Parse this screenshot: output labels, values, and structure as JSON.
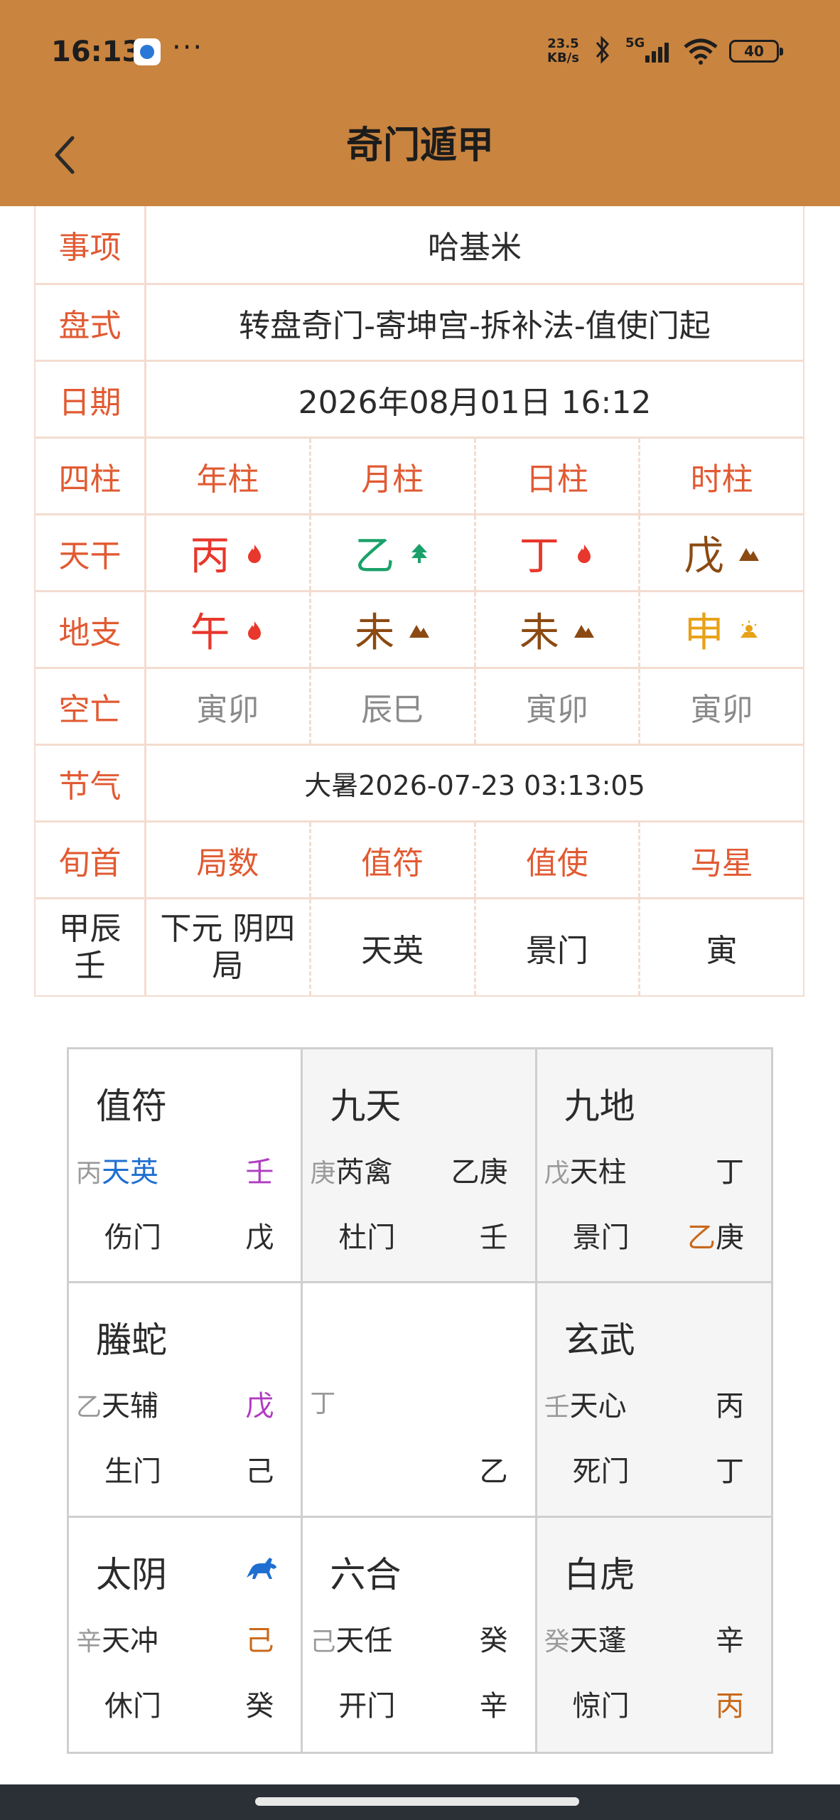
{
  "status_bar": {
    "time": "16:13",
    "more": "···",
    "net_speed_value": "23.5",
    "net_speed_unit": "KB/s",
    "network": "5G",
    "battery": "40",
    "icons": [
      "app-notification-icon",
      "bluetooth-icon",
      "cellular-signal-icon",
      "wifi-icon",
      "battery-icon"
    ]
  },
  "header": {
    "title": "奇门遁甲",
    "back_icon": "chevron-left-icon"
  },
  "info": {
    "matter": {
      "label": "事项",
      "value": "哈基米"
    },
    "layout": {
      "label": "盘式",
      "value": "转盘奇门-寄坤宫-拆补法-值使门起"
    },
    "date": {
      "label": "日期",
      "value": "2026年08月01日 16:12"
    },
    "pillars_header": {
      "label": "四柱",
      "cols": [
        "年柱",
        "月柱",
        "日柱",
        "时柱"
      ]
    },
    "stems": {
      "label": "天干",
      "values": [
        "丙",
        "乙",
        "丁",
        "戊"
      ],
      "elements": [
        "fire",
        "wood",
        "fire",
        "earth"
      ]
    },
    "branches": {
      "label": "地支",
      "values": [
        "午",
        "未",
        "未",
        "申"
      ],
      "elements": [
        "fire",
        "earth",
        "earth",
        "metal"
      ]
    },
    "void": {
      "label": "空亡",
      "values": [
        "寅卯",
        "辰巳",
        "寅卯",
        "寅卯"
      ]
    },
    "solar_term": {
      "label": "节气",
      "value": "大暑2026-07-23 03:13:05"
    },
    "summary_header": {
      "label": "旬首",
      "cols": [
        "局数",
        "值符",
        "值使",
        "马星"
      ]
    },
    "summary": {
      "xunshou_line1": "甲辰",
      "xunshou_line2": "壬",
      "ju_line1": "下元 阴四",
      "ju_line2": "局",
      "zhifu": "天英",
      "zhishi": "景门",
      "horse": "寅"
    }
  },
  "element_colors": {
    "fire": "#e8372c",
    "wood": "#1aa169",
    "earth": "#8b4a12",
    "metal": "#e8a218"
  },
  "board": {
    "palaces": [
      {
        "god": "值符",
        "star_stem": "丙",
        "star": "天英",
        "tr_stem": "壬",
        "door": "伤门",
        "br_stem": "戊",
        "shade": false
      },
      {
        "god": "九天",
        "star_stem": "庚",
        "star": "芮禽",
        "tr_stem": "乙庚",
        "door": "杜门",
        "br_stem": "壬",
        "shade": true
      },
      {
        "god": "九地",
        "star_stem": "戊",
        "star": "天柱",
        "tr_stem": "丁",
        "door": "景门",
        "br_stem_a": "乙",
        "br_stem_b": "庚",
        "shade": true
      },
      {
        "god": "螣蛇",
        "star_stem": "乙",
        "star": "天辅",
        "tr_stem": "戊",
        "door": "生门",
        "br_stem": "己",
        "shade": false
      },
      {
        "center_top": "丁",
        "center_bottom": "乙",
        "shade": false
      },
      {
        "god": "玄武",
        "star_stem": "壬",
        "star": "天心",
        "tr_stem": "丙",
        "door": "死门",
        "br_stem": "丁",
        "shade": true
      },
      {
        "god": "太阴",
        "star_stem": "辛",
        "star": "天冲",
        "tr_stem": "己",
        "door": "休门",
        "br_stem": "癸",
        "marker_icon": "horse-icon",
        "shade": false
      },
      {
        "god": "六合",
        "star_stem": "己",
        "star": "天任",
        "tr_stem": "癸",
        "door": "开门",
        "br_stem": "辛",
        "shade": false
      },
      {
        "god": "白虎",
        "star_stem": "癸",
        "star": "天蓬",
        "tr_stem": "辛",
        "door": "惊门",
        "br_stem": "丙",
        "shade": true
      }
    ]
  }
}
